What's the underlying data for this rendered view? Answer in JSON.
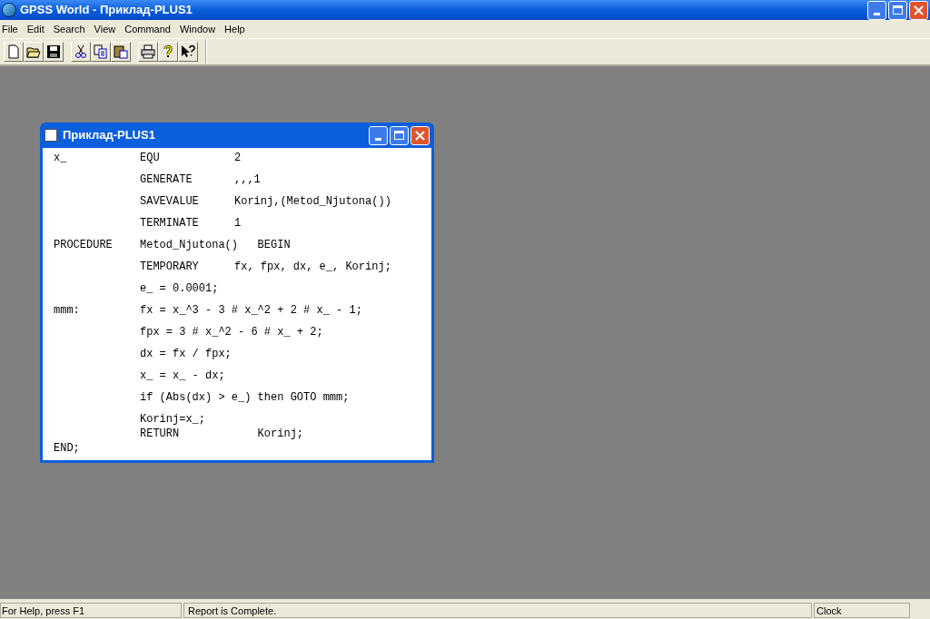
{
  "window": {
    "title": "GPSS World - Приклад-PLUS1"
  },
  "menu": [
    "File",
    "Edit",
    "Search",
    "View",
    "Command",
    "Window",
    "Help"
  ],
  "toolbar": [
    {
      "kind": "new"
    },
    {
      "kind": "open"
    },
    {
      "kind": "save"
    },
    {
      "kind": "sep"
    },
    {
      "kind": "cut"
    },
    {
      "kind": "copy"
    },
    {
      "kind": "paste"
    },
    {
      "kind": "sep"
    },
    {
      "kind": "print"
    },
    {
      "kind": "help"
    },
    {
      "kind": "context-help"
    }
  ],
  "document": {
    "title": "Приклад-PLUS1",
    "lines": [
      {
        "label": "x_",
        "op": "EQU",
        "arg": "2",
        "tight": false
      },
      {
        "op": "GENERATE",
        "arg": ",,,1",
        "tight": false
      },
      {
        "op": "SAVEVALUE",
        "arg": "Korinj,(Metod_Njutona())",
        "tight": false
      },
      {
        "op": "TERMINATE",
        "arg": "1",
        "tight": false
      },
      {
        "label": "PROCEDURE",
        "op": "Metod_Njutona()   BEGIN",
        "tight": false
      },
      {
        "op": "TEMPORARY",
        "arg": "fx, fpx, dx, e_, Korinj;",
        "tight": false
      },
      {
        "op": "e_ = 0.0001;",
        "tight": false
      },
      {
        "label": "mmm:",
        "op": "fx = x_^3 - 3 # x_^2 + 2 # x_ - 1;",
        "tight": false
      },
      {
        "op": "fpx = 3 # x_^2 - 6 # x_ + 2;",
        "tight": false
      },
      {
        "op": "dx = fx / fpx;",
        "tight": false
      },
      {
        "op": "x_ = x_ - dx;",
        "tight": false
      },
      {
        "op": "if (Abs(dx) > e_) then GOTO mmm;",
        "tight": false
      },
      {
        "op": "Korinj=x_;",
        "tight": true
      },
      {
        "op": "RETURN            Korinj;",
        "tight": true
      },
      {
        "label": "END;",
        "tight": true
      }
    ]
  },
  "status_bar": {
    "help": "For Help, press F1",
    "message": "Report is Complete.",
    "clock": "Clock"
  }
}
